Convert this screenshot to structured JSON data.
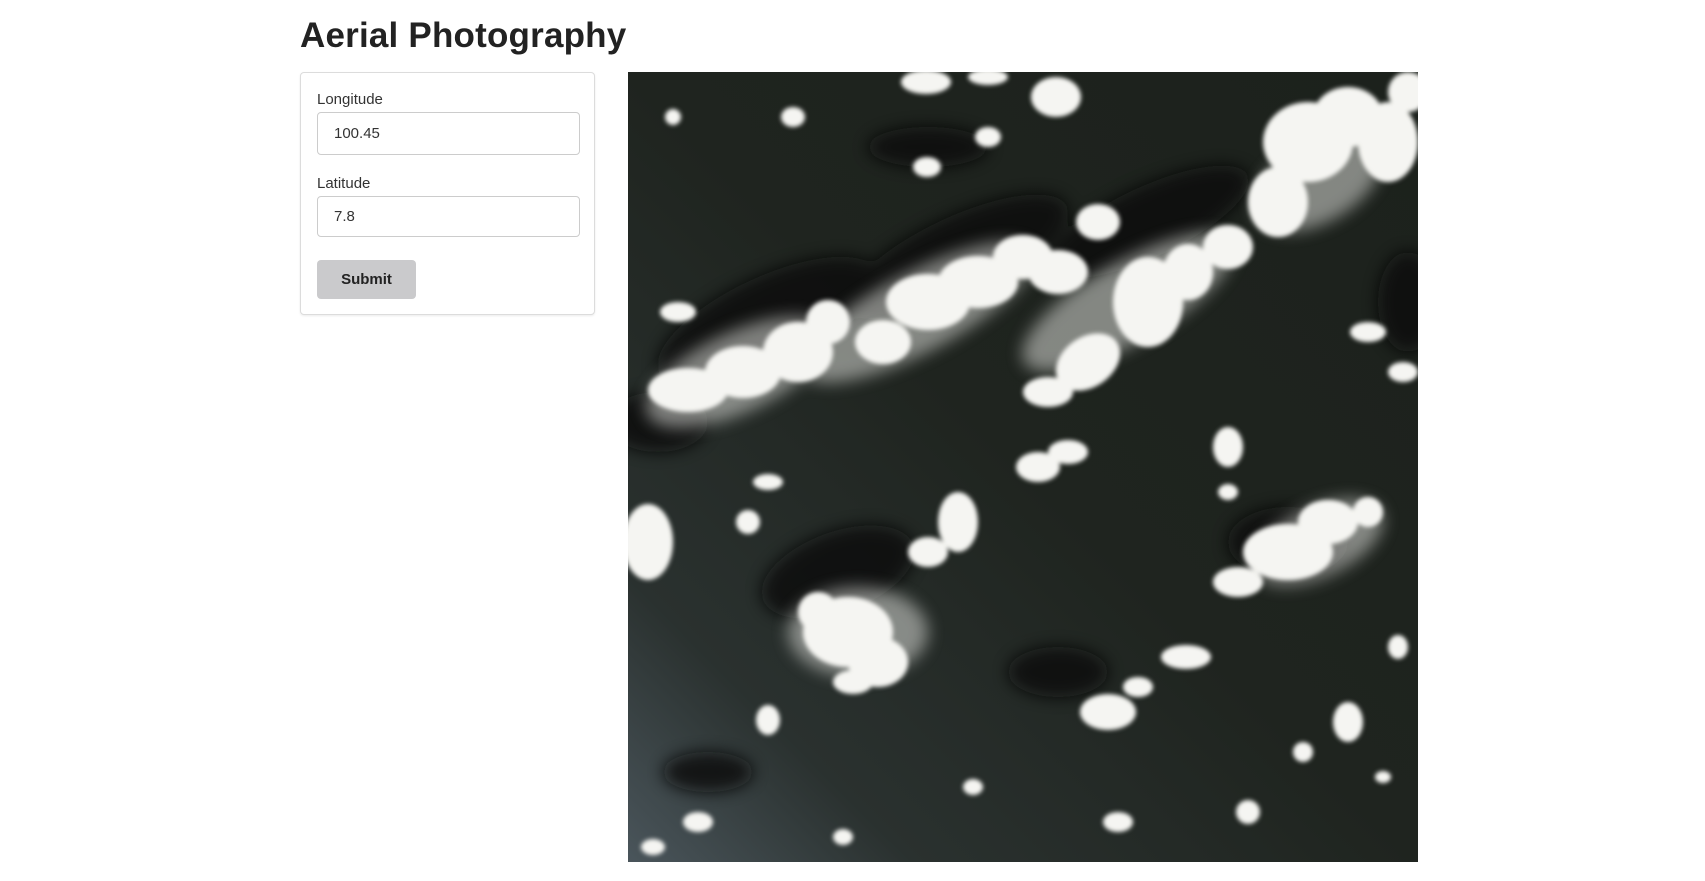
{
  "page": {
    "title": "Aerial Photography"
  },
  "form": {
    "longitude": {
      "label": "Longitude",
      "value": "100.45"
    },
    "latitude": {
      "label": "Latitude",
      "value": "7.8"
    },
    "submit_label": "Submit"
  },
  "photo": {
    "subject": "satellite image of scattered white clouds over dark ocean",
    "colors": {
      "ocean": "#1f231e",
      "ocean_light": "#4f5a60",
      "shadow": "#0f120f",
      "cloud": "#f4f4f2"
    }
  }
}
